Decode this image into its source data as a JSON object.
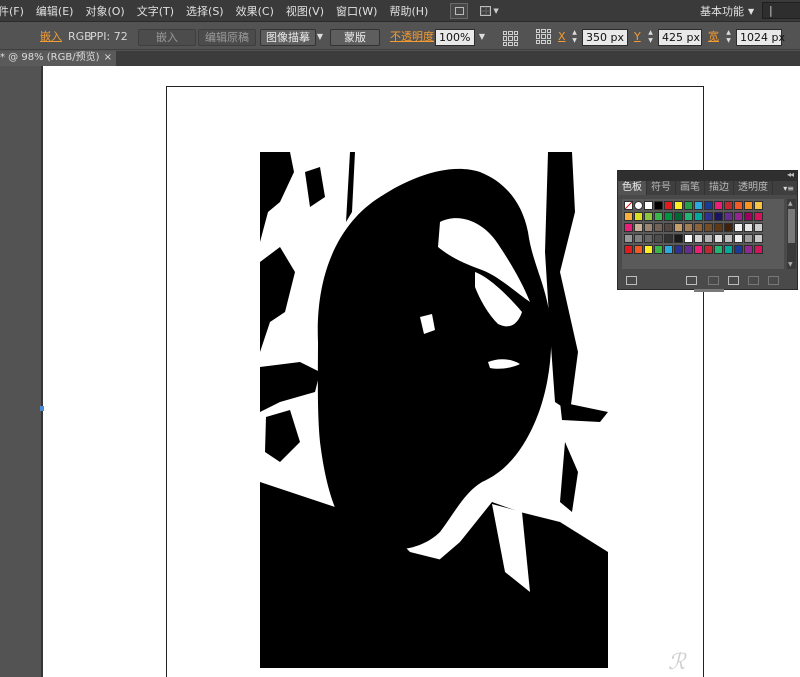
{
  "menu": {
    "items": [
      "件(F)",
      "编辑(E)",
      "对象(O)",
      "文字(T)",
      "选择(S)",
      "效果(C)",
      "视图(V)",
      "窗口(W)",
      "帮助(H)"
    ],
    "workspace_label": "基本功能",
    "search_text": "|"
  },
  "control_bar": {
    "embedded_label": "嵌入",
    "color_mode": "RGB",
    "ppi_label": "PPI: 72",
    "embed_button": "嵌入",
    "edit_original_button": "编辑原稿",
    "image_trace_button": "图像描摹",
    "mask_button": "蒙版",
    "opacity_label": "不透明度",
    "opacity_value": "100%",
    "x_label": "X",
    "x_value": "350 px",
    "y_label": "Y",
    "y_value": "425 px",
    "width_label": "宽",
    "width_value": "1024 px"
  },
  "document_tab": {
    "title": "* @ 98% (RGB/预览)",
    "close": "×"
  },
  "swatches_panel": {
    "collapse": "◂◂",
    "menu": "▾≡",
    "tabs": [
      "色板",
      "符号",
      "画笔",
      "描边",
      "透明度"
    ],
    "active_tab": "色板",
    "rows": [
      [
        "none",
        "register",
        "#ffffff",
        "#000000",
        "#e4191f",
        "#fcee21",
        "#23a24a",
        "#29abe2",
        "#1b3997",
        "#ed1e79",
        "#c1272d",
        "#f15a24",
        "#f7931e",
        "#f6c343"
      ],
      [
        "#fbb03b",
        "#d9e021",
        "#8cc63f",
        "#39b54a",
        "#009245",
        "#006837",
        "#22b573",
        "#00a99d",
        "#2e3192",
        "#1b1464",
        "#662d91",
        "#93278f",
        "#9e005d",
        "#d4145a"
      ],
      [
        "#ed1e79",
        "#c7b299",
        "#998675",
        "#736357",
        "#534741",
        "#c69c6d",
        "#a67c52",
        "#8c6239",
        "#754c24",
        "#603813",
        "#42210b",
        "#f2f2f2",
        "#e6e6e6",
        "#cccccc"
      ],
      [
        "#999999",
        "#808080",
        "#666666",
        "#4d4d4d",
        "#333333",
        "#1a1a1a",
        "#ffffff",
        "#d4d4d4",
        "#b3b3b3",
        "#e0e0e0",
        "#bfbfbf",
        "#f0f0f0",
        "#a0a0a0",
        "#c8c8c8"
      ],
      [
        "#e4191f",
        "#f15a24",
        "#fcee21",
        "#39b54a",
        "#29abe2",
        "#2e3192",
        "#662d91",
        "#ed1e79",
        "#c1272d",
        "#22b573",
        "#00a99d",
        "#1b3997",
        "#93278f",
        "#d4145a"
      ]
    ]
  },
  "watermark_text": "ℛ"
}
